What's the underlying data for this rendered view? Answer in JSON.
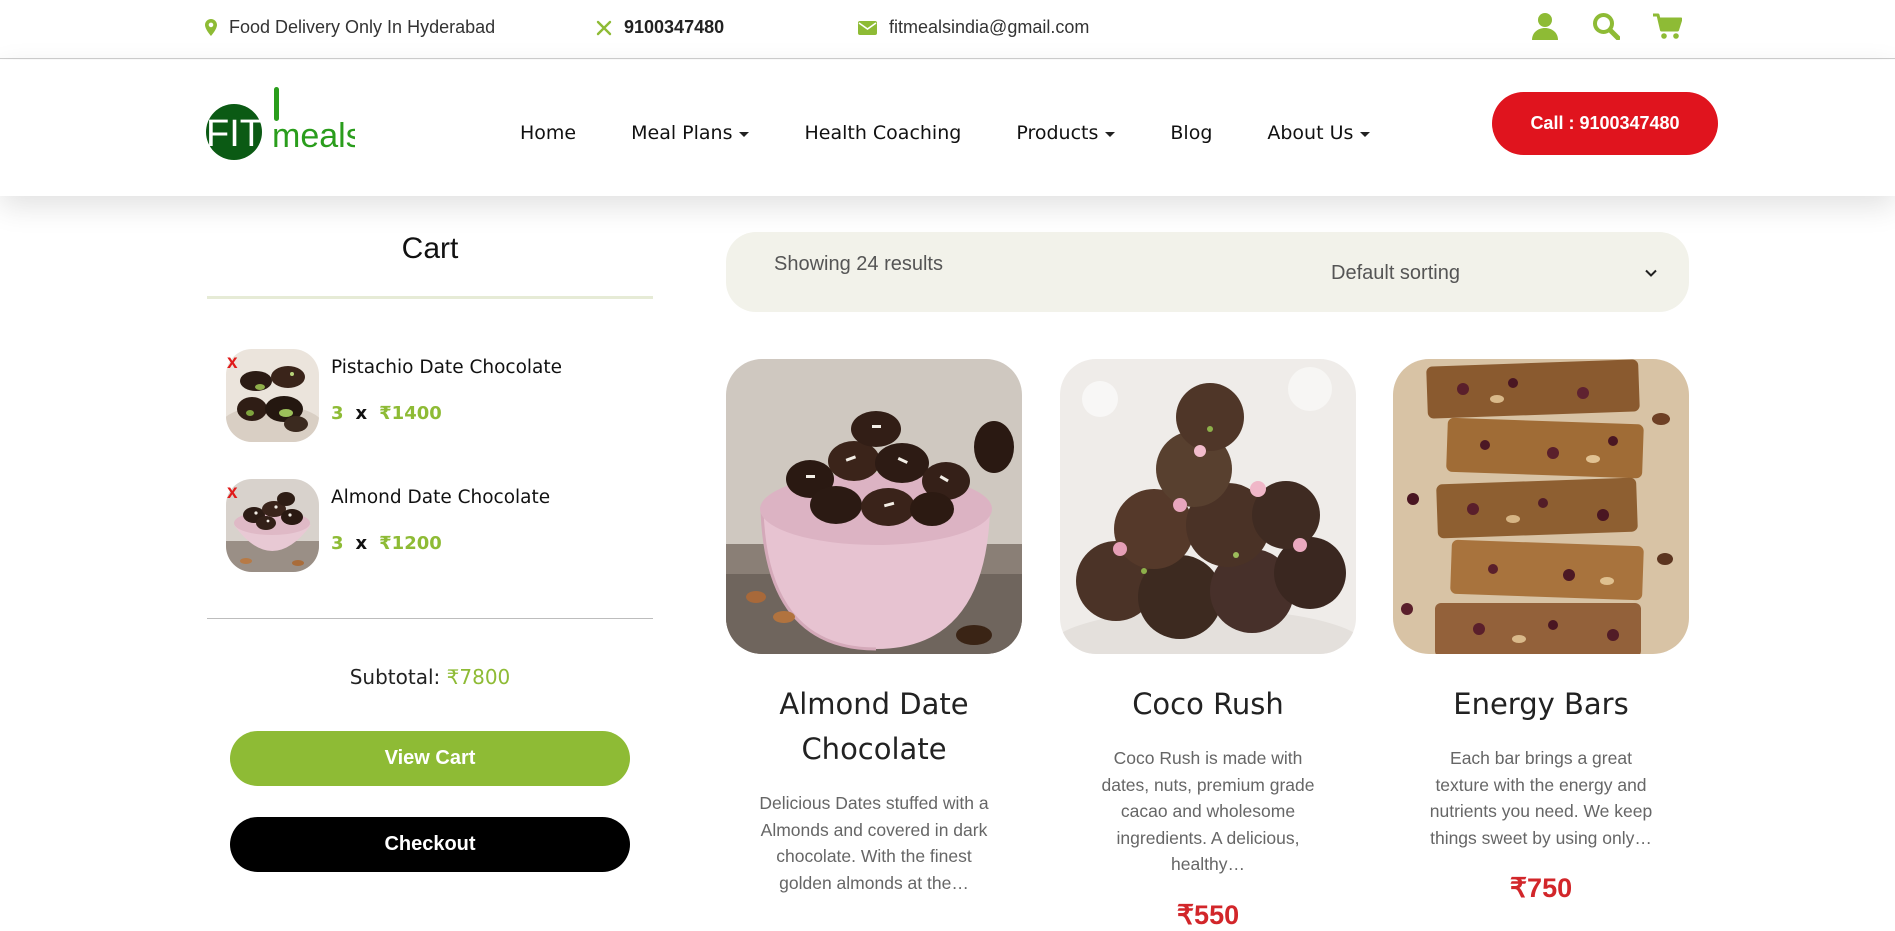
{
  "topbar": {
    "location": "Food Delivery Only In Hyderabad",
    "phone": "9100347480",
    "email": "fitmealsindia@gmail.com"
  },
  "brand": {
    "logo_part1": "FIT",
    "logo_part2": "meals"
  },
  "nav": {
    "items": [
      {
        "label": "Home",
        "dropdown": false
      },
      {
        "label": "Meal Plans",
        "dropdown": true
      },
      {
        "label": "Health Coaching",
        "dropdown": false
      },
      {
        "label": "Products",
        "dropdown": true
      },
      {
        "label": "Blog",
        "dropdown": false
      },
      {
        "label": "About Us",
        "dropdown": true
      }
    ],
    "call_button": "Call : 9100347480"
  },
  "cart": {
    "title": "Cart",
    "remove_icon": "x",
    "items": [
      {
        "name": "Pistachio Date Chocolate",
        "qty": "3",
        "times": "x",
        "price": "₹1400"
      },
      {
        "name": "Almond Date Chocolate",
        "qty": "3",
        "times": "x",
        "price": "₹1200"
      }
    ],
    "subtotal_label": "Subtotal:",
    "subtotal_value": "₹7800",
    "view_cart": "View Cart",
    "checkout": "Checkout"
  },
  "shop": {
    "results_text": "Showing 24 results",
    "sorting_selected": "Default sorting",
    "products": [
      {
        "name": "Almond Date Chocolate",
        "description": "Delicious Dates stuffed with a Almonds and covered in dark chocolate. With the finest golden almonds at the…",
        "price": ""
      },
      {
        "name": "Coco Rush",
        "description": "Coco Rush is made with dates, nuts, premium grade cacao and wholesome ingredients. A delicious, healthy…",
        "price": "₹550"
      },
      {
        "name": "Energy Bars",
        "description": "Each bar brings a great texture with the energy and nutrients you need. We keep things sweet by using only…",
        "price": "₹750"
      }
    ]
  },
  "colors": {
    "accent_green": "#8ebb35",
    "brand_dark_green": "#0b5a14",
    "call_red": "#e0141e",
    "price_red": "#d2262a"
  }
}
